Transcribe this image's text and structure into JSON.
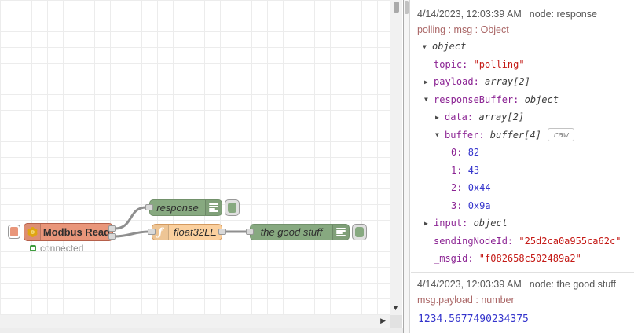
{
  "icons": {
    "scroll_down": "▼",
    "scroll_right": "▶",
    "function_glyph": "ƒ"
  },
  "flow": {
    "modbus": {
      "label": "Modbus Read",
      "color": "#E9967A",
      "status": "connected"
    },
    "response": {
      "label": "response",
      "color": "#87A980"
    },
    "function": {
      "label": "float32LE",
      "color": "#FBD09E"
    },
    "good_stuff": {
      "label": "the good stuff",
      "color": "#87A980"
    }
  },
  "debug": {
    "messages": [
      {
        "timestamp": "4/14/2023, 12:03:39 AM",
        "node": "node: response",
        "path": "polling : msg : Object",
        "rows": [
          {
            "caret": "▼",
            "type": "object"
          },
          {
            "key": "topic: ",
            "string": "\"polling\""
          },
          {
            "caret": "▶",
            "key": "payload: ",
            "type": "array[2]"
          },
          {
            "caret": "▼",
            "key": "responseBuffer: ",
            "type": "object"
          },
          {
            "caret": "▶",
            "key": "data: ",
            "type": "array[2]"
          },
          {
            "caret": "▼",
            "key": "buffer: ",
            "type": "buffer[4]",
            "raw_button": "raw"
          },
          {
            "key": "0: ",
            "number": "82"
          },
          {
            "key": "1: ",
            "number": "43"
          },
          {
            "key": "2: ",
            "number": "0x44"
          },
          {
            "key": "3: ",
            "number": "0x9a"
          },
          {
            "caret": "▶",
            "key": "input: ",
            "type": "object"
          },
          {
            "key": "sendingNodeId: ",
            "string": "\"25d2ca0a955ca62c\""
          },
          {
            "key": "_msgid: ",
            "string": "\"f082658c502489a2\""
          }
        ]
      },
      {
        "timestamp": "4/14/2023, 12:03:39 AM",
        "node": "node: the good stuff",
        "path": "msg.payload : number",
        "value": "1234.5677490234375"
      }
    ]
  }
}
